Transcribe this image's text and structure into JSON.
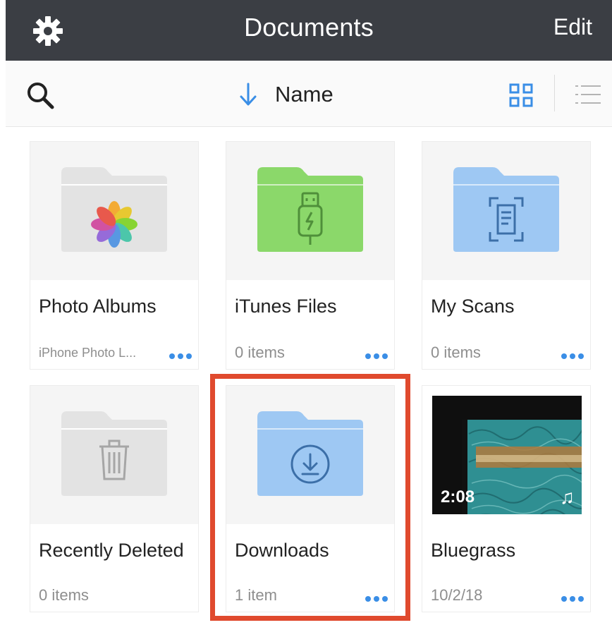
{
  "header": {
    "title": "Documents",
    "edit_label": "Edit",
    "settings_icon": "gear-icon"
  },
  "toolbar": {
    "search_icon": "search-icon",
    "sort_label": "Name",
    "sort_icon": "arrow-down-icon",
    "grid_view_icon": "grid-view-icon",
    "list_view_icon": "list-view-icon"
  },
  "colors": {
    "header_bg": "#3b3e44",
    "accent_blue": "#3a8ee6",
    "folder_gray": "#e3e3e3",
    "folder_green": "#8bd86a",
    "folder_blue": "#9ec8f3",
    "highlight_red": "#e04a2e"
  },
  "items": [
    {
      "name": "Photo Albums",
      "meta": "iPhone Photo L...",
      "kind": "gray-folder",
      "icon": "photos-icon"
    },
    {
      "name": "iTunes Files",
      "meta": "0 items",
      "kind": "green-folder",
      "icon": "usb-icon"
    },
    {
      "name": "My Scans",
      "meta": "0 items",
      "kind": "blue-folder",
      "icon": "scan-document-icon"
    },
    {
      "name": "Recently Deleted",
      "meta": "0 items",
      "kind": "gray-folder",
      "icon": "trash-icon"
    },
    {
      "name": "Downloads",
      "meta": "1 item",
      "kind": "blue-folder",
      "icon": "download-icon"
    },
    {
      "name": "Bluegrass",
      "meta": "10/2/18",
      "kind": "video",
      "duration": "2:08",
      "icon": "music-note-icon"
    }
  ],
  "more_icon": "more-dots-icon"
}
